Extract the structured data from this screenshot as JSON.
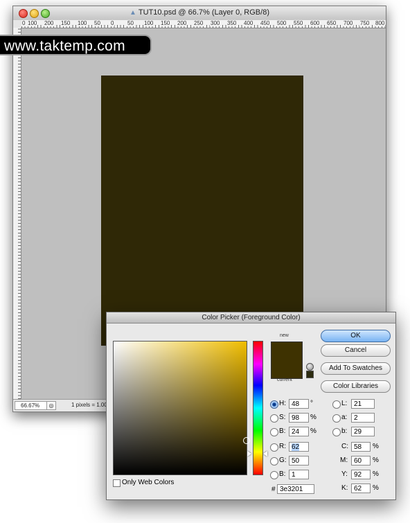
{
  "document": {
    "title": "TUT10.psd @ 66.7% (Layer 0, RGB/8)",
    "ruler_labels": [
      "0",
      "100",
      "200",
      "150",
      "100",
      "50",
      "0",
      "50",
      "100",
      "150",
      "200",
      "250",
      "300",
      "350",
      "400",
      "450",
      "500",
      "550",
      "600",
      "650",
      "700",
      "750",
      "800"
    ],
    "canvas_color": "#2f2806",
    "zoom_value": "66.67%",
    "status_text": "1 pixels = 1.0000"
  },
  "watermark": {
    "text": "www.taktemp.com"
  },
  "picker": {
    "title": "Color Picker (Foreground Color)",
    "new_label": "new",
    "current_label": "current",
    "new_color": "#3e3201",
    "hue_color": "#f0bd00",
    "buttons": {
      "ok": "OK",
      "cancel": "Cancel",
      "add_swatches": "Add To Swatches",
      "libraries": "Color Libraries"
    },
    "hsb": [
      {
        "label": "H:",
        "value": "48",
        "unit": "°",
        "checked": true
      },
      {
        "label": "S:",
        "value": "98",
        "unit": "%",
        "checked": false
      },
      {
        "label": "B:",
        "value": "24",
        "unit": "%",
        "checked": false
      }
    ],
    "rgb": [
      {
        "label": "R:",
        "value": "62",
        "checked": false
      },
      {
        "label": "G:",
        "value": "50",
        "checked": false
      },
      {
        "label": "B:",
        "value": "1",
        "checked": false
      }
    ],
    "lab": [
      {
        "label": "L:",
        "value": "21"
      },
      {
        "label": "a:",
        "value": "2"
      },
      {
        "label": "b:",
        "value": "29"
      }
    ],
    "cmyk": [
      {
        "label": "C:",
        "value": "58",
        "unit": "%"
      },
      {
        "label": "M:",
        "value": "60",
        "unit": "%"
      },
      {
        "label": "Y:",
        "value": "92",
        "unit": "%"
      },
      {
        "label": "K:",
        "value": "62",
        "unit": "%"
      }
    ],
    "only_web_colors": "Only Web Colors",
    "hex_hash": "#",
    "hex_value": "3e3201"
  }
}
